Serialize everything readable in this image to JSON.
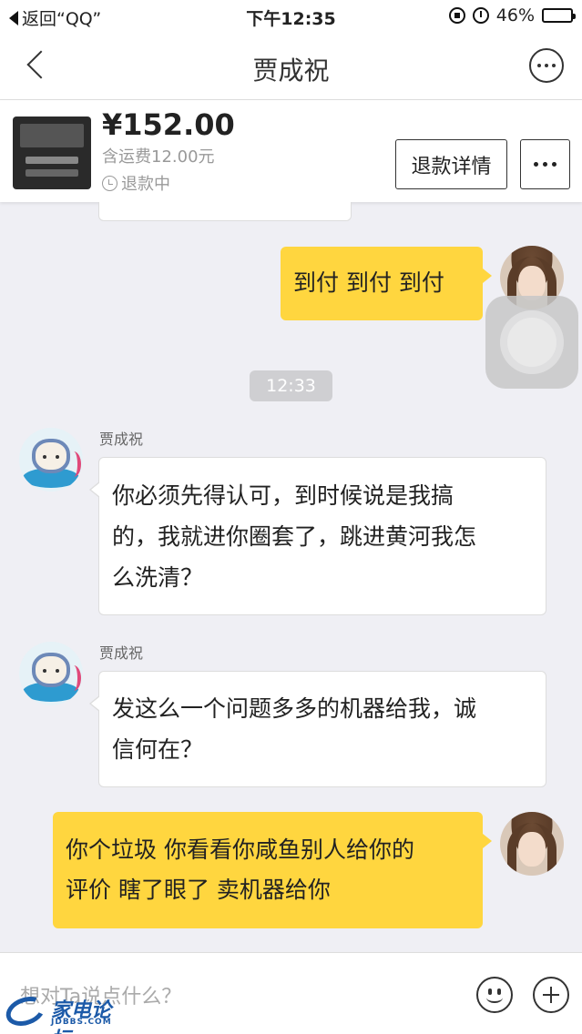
{
  "status_bar": {
    "back_label": "返回“QQ”",
    "time": "下午12:35",
    "battery": "46%",
    "battery_level": 0.46
  },
  "nav": {
    "title": "贾成祝"
  },
  "product": {
    "price": "¥152.00",
    "shipping": "含运费12.00元",
    "status": "退款中",
    "refund_button": "退款详情"
  },
  "messages": {
    "m1": {
      "text": "到付 到付 到付"
    },
    "time_divider": "12:33",
    "m2": {
      "sender": "贾成祝",
      "lines": [
        "你必须先得认可，到时候说是我搞",
        "的，我就进你圈套了，跳进黄河我怎",
        "么洗清？"
      ]
    },
    "m3": {
      "sender": "贾成祝",
      "lines": [
        "发这么一个问题多多的机器给我，诚",
        "信何在？"
      ]
    },
    "m4": {
      "lines": [
        "你个垃圾 你看看你咸鱼别人给你的",
        "评价 瞎了眼了 卖机器给你"
      ]
    }
  },
  "input": {
    "placeholder": "想对Ta说点什么？"
  },
  "watermark": {
    "main": "家电论坛",
    "sub": "JDBBS.COM"
  },
  "colors": {
    "accent_yellow": "#ffd63f",
    "background": "#efeff4"
  }
}
